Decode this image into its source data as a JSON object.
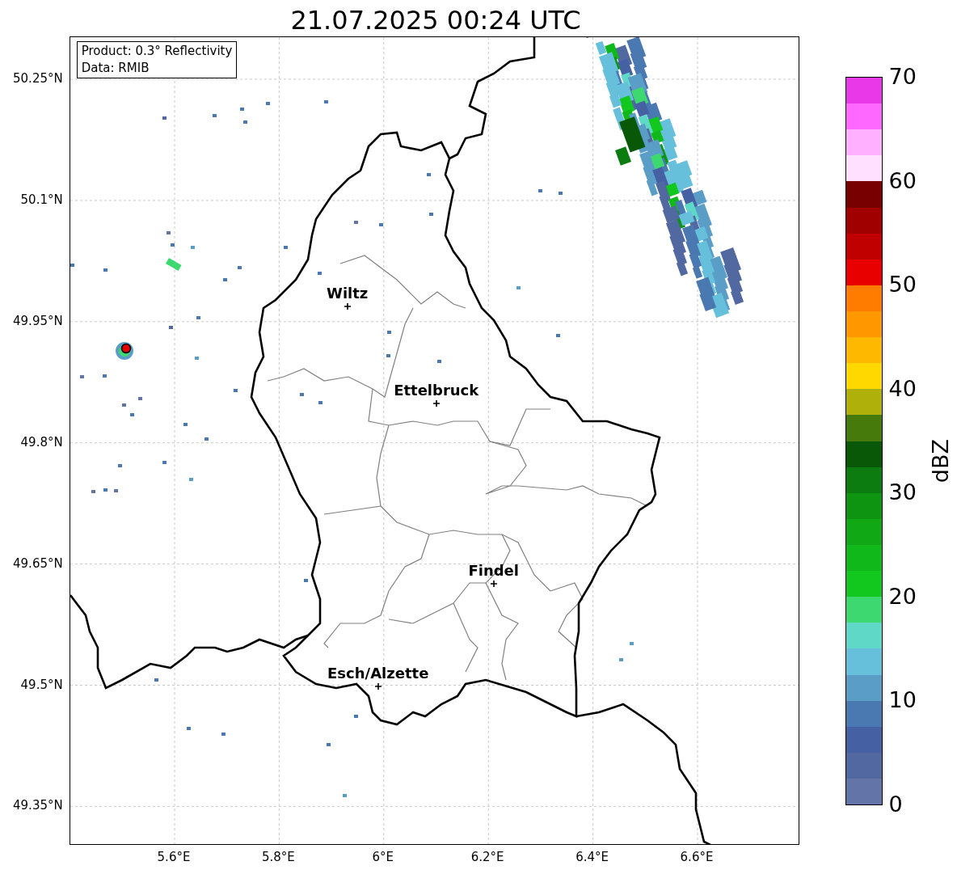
{
  "title": "21.07.2025 00:24 UTC",
  "info": {
    "lines": [
      "Product: 0.3° Reflectivity",
      "Data: RMIB"
    ]
  },
  "map": {
    "y_ticks": [
      "50.25°N",
      "50.1°N",
      "49.95°N",
      "49.8°N",
      "49.65°N",
      "49.5°N",
      "49.35°N"
    ],
    "x_ticks": [
      "5.6°E",
      "5.8°E",
      "6°E",
      "6.2°E",
      "6.4°E",
      "6.6°E"
    ],
    "places": [
      {
        "name": "Wiltz"
      },
      {
        "name": "Ettelbruck"
      },
      {
        "name": "Findel"
      },
      {
        "name": "Esch/Alzette"
      }
    ]
  },
  "colorbar": {
    "label": "dBZ",
    "ticks": [
      "70",
      "60",
      "50",
      "40",
      "30",
      "20",
      "10",
      "0"
    ],
    "segments": [
      {
        "color": "#e838e8"
      },
      {
        "color": "#ff68ff"
      },
      {
        "color": "#ffb0ff"
      },
      {
        "color": "#ffe0ff"
      },
      {
        "color": "#780000"
      },
      {
        "color": "#a00000"
      },
      {
        "color": "#c00000"
      },
      {
        "color": "#e80000"
      },
      {
        "color": "#ff7c00"
      },
      {
        "color": "#ff9800"
      },
      {
        "color": "#ffb800"
      },
      {
        "color": "#ffd800"
      },
      {
        "color": "#b0b00a"
      },
      {
        "color": "#467a0a"
      },
      {
        "color": "#085808"
      },
      {
        "color": "#0c7c10"
      },
      {
        "color": "#0e9410"
      },
      {
        "color": "#10a814"
      },
      {
        "color": "#10b81a"
      },
      {
        "color": "#12c81e"
      },
      {
        "color": "#3ed870"
      },
      {
        "color": "#60d8c8"
      },
      {
        "color": "#66c0dc"
      },
      {
        "color": "#5a9ec8"
      },
      {
        "color": "#4a78b0"
      },
      {
        "color": "#4660a4"
      },
      {
        "color": "#5168a0"
      },
      {
        "color": "#6374a8"
      }
    ]
  }
}
